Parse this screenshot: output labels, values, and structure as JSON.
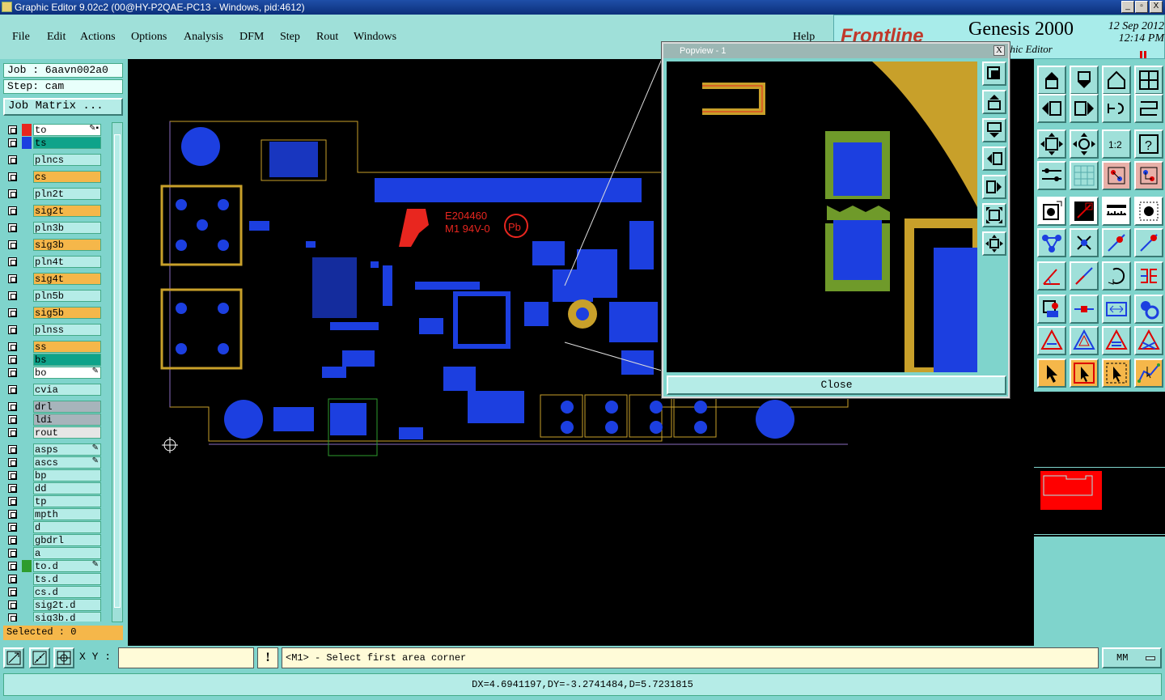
{
  "window": {
    "title": "Graphic Editor 9.02c2 (00@HY-P2QAE-PC13 - Windows, pid:4612)",
    "buttons": [
      "_",
      "▫",
      "X"
    ]
  },
  "menu": {
    "items": [
      "File",
      "Edit",
      "Actions",
      "Options",
      "Analysis",
      "DFM",
      "Step",
      "Rout",
      "Windows"
    ],
    "help": "Help"
  },
  "logo": {
    "brand": "Frontline",
    "product": "Genesis 2000",
    "subtitle": "Graphic Editor",
    "date_line1": "12 Sep 2012",
    "date_line2": "12:14 PM"
  },
  "job": {
    "job_label": "Job : 6aavn002a0",
    "step_label": "Step: cam",
    "matrix_button": "Job Matrix ..."
  },
  "layers": [
    {
      "name": "to",
      "color": "#ffffff",
      "swatch": "#e8261f",
      "mark": "✎▪"
    },
    {
      "name": "ts",
      "color": "#0fa38a",
      "swatch": "#1c3fe0",
      "mark": ""
    },
    {
      "name": "plncs",
      "color": "#b5ece7",
      "swatch": "",
      "mark": ""
    },
    {
      "name": "cs",
      "color": "#f5b74a",
      "swatch": "",
      "mark": ""
    },
    {
      "name": "pln2t",
      "color": "#b5ece7",
      "swatch": "",
      "mark": ""
    },
    {
      "name": "sig2t",
      "color": "#f5b74a",
      "swatch": "",
      "mark": ""
    },
    {
      "name": "pln3b",
      "color": "#b5ece7",
      "swatch": "",
      "mark": ""
    },
    {
      "name": "sig3b",
      "color": "#f5b74a",
      "swatch": "",
      "mark": ""
    },
    {
      "name": "pln4t",
      "color": "#b5ece7",
      "swatch": "",
      "mark": ""
    },
    {
      "name": "sig4t",
      "color": "#f5b74a",
      "swatch": "",
      "mark": ""
    },
    {
      "name": "pln5b",
      "color": "#b5ece7",
      "swatch": "",
      "mark": ""
    },
    {
      "name": "sig5b",
      "color": "#f5b74a",
      "swatch": "",
      "mark": ""
    },
    {
      "name": "plnss",
      "color": "#b5ece7",
      "swatch": "",
      "mark": ""
    },
    {
      "name": "ss",
      "color": "#f5b74a",
      "swatch": "",
      "mark": ""
    },
    {
      "name": "bs",
      "color": "#0fa38a",
      "swatch": "",
      "mark": ""
    },
    {
      "name": "bo",
      "color": "#ffffff",
      "swatch": "",
      "mark": "✎"
    },
    {
      "name": "cvia",
      "color": "#b5ece7",
      "swatch": "",
      "mark": ""
    },
    {
      "name": "drl",
      "color": "#a7b4bb",
      "swatch": "",
      "mark": ""
    },
    {
      "name": "ldi",
      "color": "#a7b4bb",
      "swatch": "",
      "mark": ""
    },
    {
      "name": "rout",
      "color": "#e6e6e6",
      "swatch": "",
      "mark": ""
    },
    {
      "name": "asps",
      "color": "#b5ece7",
      "swatch": "",
      "mark": "✎"
    },
    {
      "name": "ascs",
      "color": "#b5ece7",
      "swatch": "",
      "mark": "✎"
    },
    {
      "name": "bp",
      "color": "#b5ece7",
      "swatch": "",
      "mark": ""
    },
    {
      "name": "dd",
      "color": "#b5ece7",
      "swatch": "",
      "mark": ""
    },
    {
      "name": "tp",
      "color": "#b5ece7",
      "swatch": "",
      "mark": ""
    },
    {
      "name": "mpth",
      "color": "#b5ece7",
      "swatch": "",
      "mark": ""
    },
    {
      "name": "d",
      "color": "#b5ece7",
      "swatch": "",
      "mark": ""
    },
    {
      "name": "gbdrl",
      "color": "#b5ece7",
      "swatch": "",
      "mark": ""
    },
    {
      "name": "a",
      "color": "#b5ece7",
      "swatch": "",
      "mark": ""
    },
    {
      "name": "to.d",
      "color": "#b5ece7",
      "swatch": "#2e9c2e",
      "mark": "✎"
    },
    {
      "name": "ts.d",
      "color": "#b5ece7",
      "swatch": "",
      "mark": ""
    },
    {
      "name": "cs.d",
      "color": "#b5ece7",
      "swatch": "",
      "mark": ""
    },
    {
      "name": "sig2t.d",
      "color": "#b5ece7",
      "swatch": "",
      "mark": ""
    },
    {
      "name": "sig3b.d",
      "color": "#b5ece7",
      "swatch": "",
      "mark": ""
    }
  ],
  "selected": "Selected : 0",
  "pcb_labels": {
    "ul_mark": "E204460",
    "rating": "M1 94V-0",
    "pb": "Pb"
  },
  "popview": {
    "title": "Popview - 1",
    "close_x": "X",
    "close_button": "Close"
  },
  "bottom": {
    "xy_label": "X Y :",
    "xy_value": "",
    "warn": "!",
    "prompt": "<M1> - Select first area corner",
    "units": "MM"
  },
  "status": {
    "measure": "DX=4.6941197,DY=-3.2741484,D=5.7231815"
  },
  "colors": {
    "accent": "#7fd4cc",
    "pad_blue": "#1c3fe0",
    "copper": "#c8a02a",
    "alert_red": "#e8261f"
  }
}
